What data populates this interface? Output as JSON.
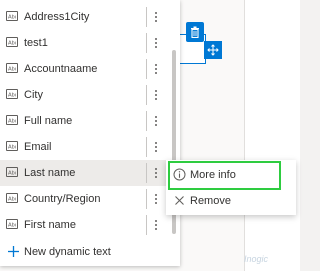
{
  "field_list": {
    "items": [
      {
        "label": "Address1City",
        "icon": "text-field-icon"
      },
      {
        "label": "test1",
        "icon": "text-field-icon"
      },
      {
        "label": "Accountnaame",
        "icon": "text-field-icon"
      },
      {
        "label": "City",
        "icon": "text-field-icon"
      },
      {
        "label": "Full name",
        "icon": "text-field-icon"
      },
      {
        "label": "Email",
        "icon": "text-field-icon"
      },
      {
        "label": "Last name",
        "icon": "text-field-icon"
      },
      {
        "label": "Country/Region",
        "icon": "text-field-icon"
      },
      {
        "label": "First name",
        "icon": "text-field-icon"
      }
    ],
    "hovered_index": 6,
    "add_label": "New dynamic text"
  },
  "context_menu": {
    "items": [
      {
        "label": "More info",
        "icon": "info-icon"
      },
      {
        "label": "Remove",
        "icon": "close-icon"
      }
    ]
  },
  "watermark": "Inogic",
  "colors": {
    "accent": "#0078d4",
    "highlight": "#2ecc40",
    "hover_row": "#edebe9"
  }
}
